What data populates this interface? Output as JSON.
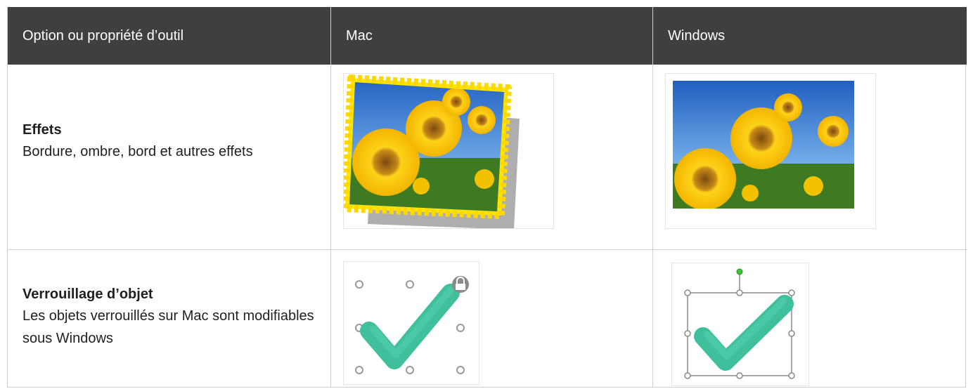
{
  "table": {
    "headers": [
      "Option ou propriété d’outil",
      "Mac",
      "Windows"
    ],
    "rows": [
      {
        "title": "Effets",
        "description": "Bordure, ombre, bord et autres effets",
        "mac_image": "sunflower-photo-wavy-border-shadow",
        "windows_image": "sunflower-photo-plain"
      },
      {
        "title": "Verrouillage d’objet",
        "description": "Les objets verrouillés sur Mac sont modifiables sous Windows",
        "mac_image": "checkmark-locked",
        "windows_image": "checkmark-selected-editable"
      }
    ]
  },
  "colors": {
    "header_bg": "#3f3f3f",
    "header_text": "#ffffff",
    "border": "#cfcfcf",
    "checkmark": "#3fbf9c",
    "wavy_border": "#ffe600",
    "handle_green": "#3ec23a"
  }
}
